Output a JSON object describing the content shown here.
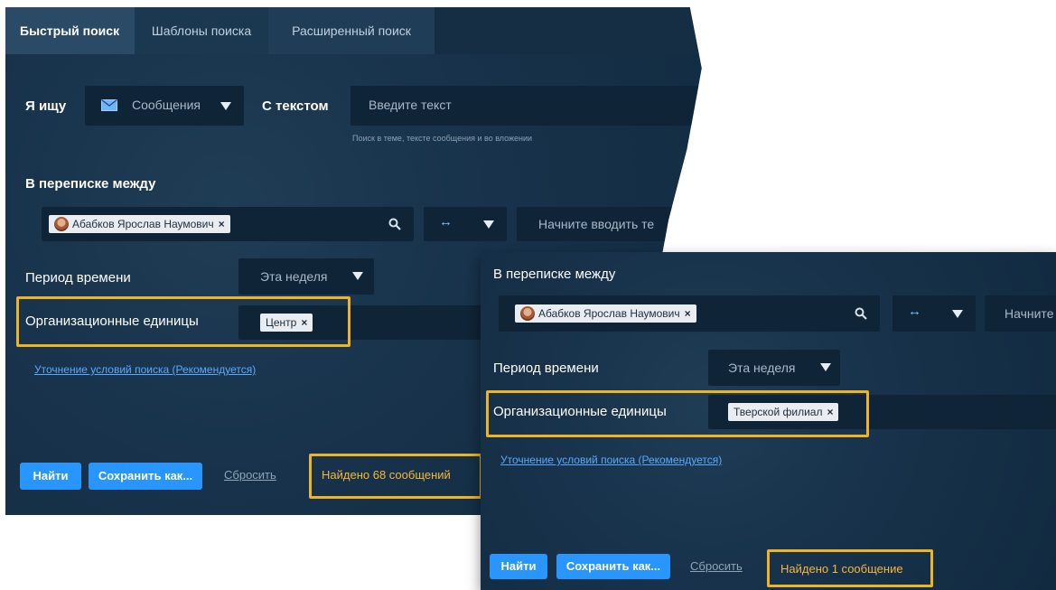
{
  "tabs": [
    "Быстрый поиск",
    "Шаблоны поиска",
    "Расширенный поиск"
  ],
  "search": {
    "i_search_label": "Я ищу",
    "type_value": "Сообщения",
    "with_text_label": "С текстом",
    "text_placeholder": "Введите текст",
    "text_hint": "Поиск в теме, тексте сообщения и во вложении"
  },
  "correspondence": {
    "label": "В переписке между",
    "person": "Абабков Ярослав Наумович",
    "second_placeholder": "Начните вводить те",
    "second_placeholder_short": "Начните"
  },
  "period": {
    "label": "Период времени",
    "value": "Эта неделя"
  },
  "org_units": {
    "label": "Организационные единицы",
    "tag_main": "Центр",
    "tag_second": "Тверской филиал"
  },
  "refine_link": "Уточнение условий поиска (Рекомендуется)",
  "buttons": {
    "find": "Найти",
    "save": "Сохранить как...",
    "reset": "Сбросить"
  },
  "results": {
    "main": "Найдено 68 сообщений",
    "second": "Найдено 1 сообщение"
  },
  "colors": {
    "accent": "#2996ff",
    "highlight": "#f0b323",
    "panel": "#17324a"
  }
}
